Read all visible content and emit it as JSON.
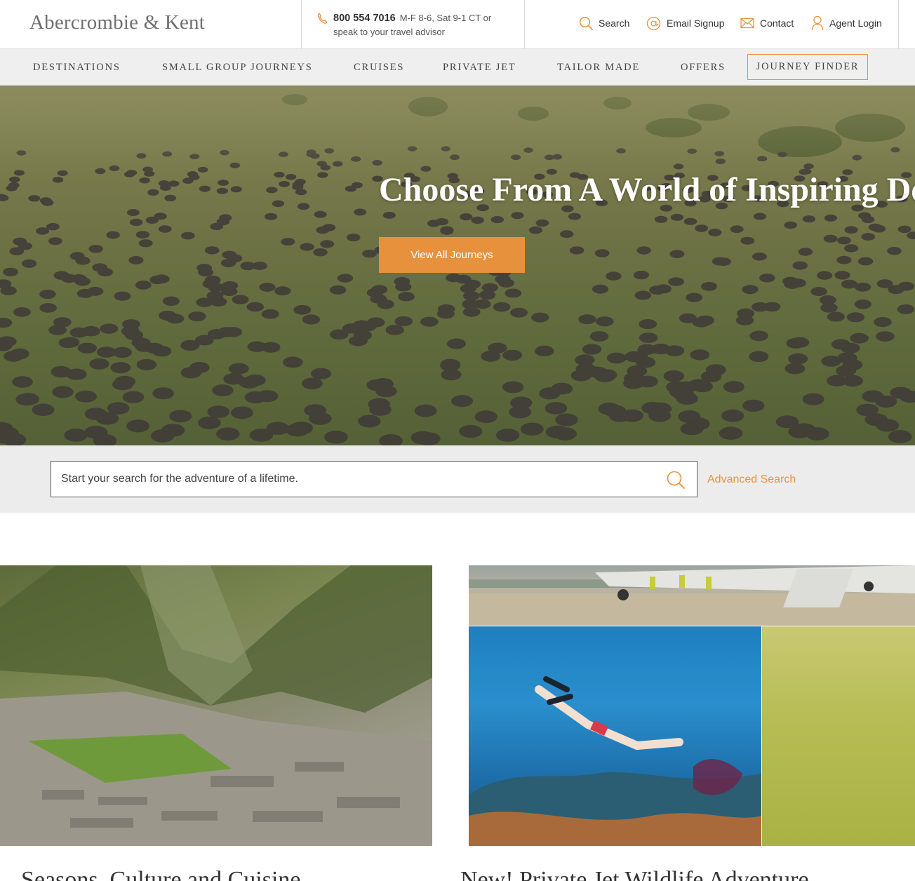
{
  "header": {
    "logo": "Abercrombie & Kent",
    "phone_number": "800 554 7016",
    "phone_hours": "M-F 8-6, Sat 9-1 CT or speak to your travel advisor",
    "links": {
      "search": "Search",
      "email_signup": "Email Signup",
      "contact": "Contact",
      "agent_login": "Agent Login"
    }
  },
  "nav": {
    "items": [
      "DESTINATIONS",
      "SMALL GROUP JOURNEYS",
      "CRUISES",
      "PRIVATE JET",
      "TAILOR MADE",
      "OFFERS"
    ],
    "journey_finder": "JOURNEY FINDER"
  },
  "hero": {
    "title": "Choose From A World of Inspiring Destinations",
    "button": "View All Journeys"
  },
  "search": {
    "placeholder": "Start your search for the adventure of a lifetime.",
    "advanced": "Advanced Search"
  },
  "cards": [
    {
      "title": "Seasons, Culture and Cuisine"
    },
    {
      "title": "New! Private Jet Wildlife Adventure"
    }
  ],
  "colors": {
    "accent": "#e8913d",
    "nav_bg": "#efefef",
    "search_band_bg": "#ececec"
  },
  "icons": [
    "phone-icon",
    "search-icon",
    "email-at-icon",
    "envelope-icon",
    "user-icon"
  ]
}
